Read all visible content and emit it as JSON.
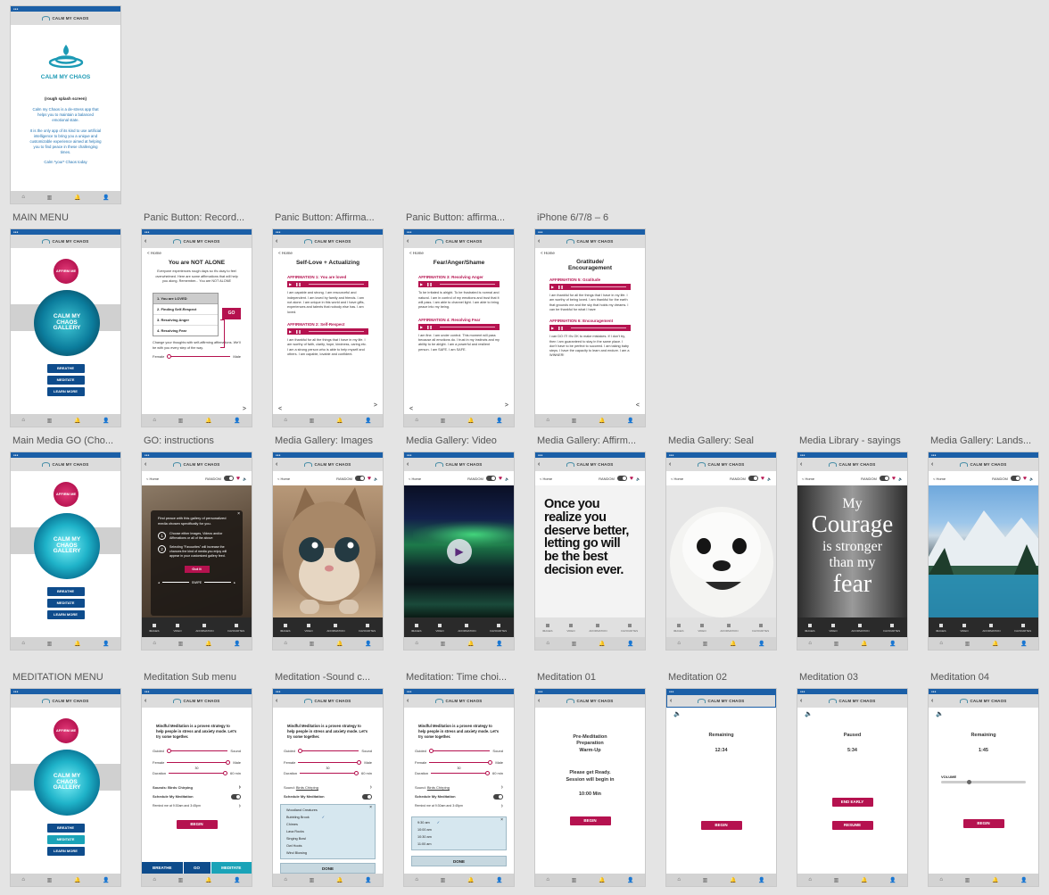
{
  "app_name": "CALM MY CHAOS",
  "tabbar": [
    "⌂",
    "▥",
    "🔔",
    "👤"
  ],
  "splash": {
    "logo_text": "CALM MY CHAOS",
    "note": "(rough splash screen)",
    "p1": "Calm my Chaos is a de-stress app that helps you to maintain a balanced emotional state.",
    "p2": "It is the only app of its kind to use artificial intelligence to bring you a unique and customizable experience aimed at helping you to find peace in these challenging times.",
    "p3": "Calm *your* Chaos today"
  },
  "labels": {
    "main_menu": "MAIN MENU",
    "panic_record": "Panic Button: Record...",
    "panic_affirm": "Panic Button: Affirma...",
    "panic_affirm2": "Panic Button: affirma...",
    "iphone": "iPhone 6/7/8 – 6",
    "main_media": "Main Media GO (Cho...",
    "go_instr": "GO: instructions",
    "mg_images": "Media Gallery: Images",
    "mg_video": "Media Gallery: Video",
    "mg_affirm": "Media Gallery: Affirm...",
    "mg_seal": "Media Gallery: Seal",
    "ml_sayings": "Media Library - sayings",
    "mg_lands": "Media Gallery: Lands...",
    "med_menu": "MEDITATION MENU",
    "med_sub": "Meditation Sub menu",
    "med_sound": "Meditation -Sound c...",
    "med_time": "Meditation: Time choi...",
    "med01": "Meditation 01",
    "med02": "Meditation 02",
    "med03": "Meditation 03",
    "med04": "Meditation 04"
  },
  "menu": {
    "affirm": "AFFIRM ME",
    "gallery": "CALM MY CHAOS GALLERY",
    "breathe": "BREATHE",
    "meditate": "MEDITATE",
    "learn": "LEARN MORE"
  },
  "panic1": {
    "home": "< Home",
    "title": "You are NOT ALONE",
    "intro": "Everyone experiences rough days so it's okay to feel overwhelmed. Here are some affirmations that will help you along. Remember... You are NOT ALONE",
    "options": [
      "1. You are LOVED",
      "2. Finding Self-Respect",
      "3. Resolving Anger",
      "4. Resolving Fear"
    ],
    "go": "GO",
    "change": "Change your thoughts with self-affirming affirmations. We'll be with you every step of the way.",
    "female": "Female",
    "male": "Male",
    "next": ">"
  },
  "panic2": {
    "home": "< Home",
    "title": "Self-Love + Actualizing",
    "a1": "AFFIRMATION 1: You are loved",
    "t1": "I am capable and strong. I am resourceful and independent. I am loved by family and friends. I am not alone. I am unique in this world and I have gifts, experiences and talents that nobody else has. I am loved.",
    "a2": "AFFIRMATION 2: Self-Respect",
    "t2": "I am thankful for all the things that I have in my life. I am worthy of faith, clarity, hope, kindness, caring etc. I am a strong person who is able to help myself and others. I am capable, lovable and confident.",
    "prev": "<",
    "next": ">"
  },
  "panic3": {
    "home": "< Home",
    "title": "Fear/Anger/Shame",
    "a1": "AFFIRMATION 3: Resolving Anger",
    "t1": "To be irritated is alright. To be frustrated is normal and natural. I am in control of my emotions and trust that it will pass. I am able to channel light. I am able to bring peace into my being.",
    "a2": "AFFIRMATION 4: Resolving Fear",
    "t2": "I am fine. I am under control. This moment will pass because all emotions do. I trust in my instincts and my ability to be alright. I am a powerful and resilient person. I am SAFE. I am SAFE.",
    "prev": "<",
    "next": ">"
  },
  "panic4": {
    "home": "< Home",
    "title": "Gratitude/ Encouragement",
    "a1": "AFFIRMATION 5: Gratitude",
    "t1": "I am thankful for all the things that I have in my life. I am worthy of being loved. I am thankful for the earth that grounds me and the sky that holds my dreams. I can be thankful for what I have",
    "a2": "AFFIRMATION 6: Encouragement",
    "t2": "I can DO IT! It's OK to make mistakes. If I don't try, then I am guaranteed to stay in the same place. I don't have to be perfect to succeed. I am taking baby steps. I have the capacity to learn and endure. I am a WINNER!",
    "prev": "<"
  },
  "media": {
    "home": "< Home",
    "random": "RANDOM",
    "nav": [
      "IMAGES",
      "VIDEO",
      "AFFIRMATION",
      "FAVOURITES"
    ]
  },
  "go_instr": {
    "intro": "Find peace with this gallery of personalized media chosen specifically for you.",
    "s1": "Choose either Images, Videos and/or Affirmations or all of the above",
    "s2": "Selecting \"Favourites\" will increase the chances the kind of media you enjoy will appear in your customized gallery feed.",
    "got": "Got It",
    "swipe": "SWIPE"
  },
  "affirm_card": "Once you realize you deserve better, letting go will be the best decision ever.",
  "saying": {
    "l1": "My",
    "l2": "Courage",
    "l3": "is stronger",
    "l4": "than my",
    "l5": "fear"
  },
  "med": {
    "intro": "Mindful Meditation is a proven strategy to help people in stress and anxiety mode. Let's try some together.",
    "guided": "Guided",
    "sound": "Sound",
    "female": "Female",
    "male": "Male",
    "duration": "Duration",
    "d_val": "60 min",
    "d_mid": "30",
    "sounds": "Sounds: Birds Chirping",
    "sound_lbl": "Sound:",
    "sound_val": "Birds Chirping",
    "schedule": "Schedule My Meditation",
    "remind": "Remind me at 9:30am and 3:45pm",
    "begin": "BEGIN",
    "bottom": [
      "BREATHE",
      "GO",
      "MEDITATE"
    ],
    "sound_list": [
      "Woodland Creatures",
      "Bubbling Brook",
      "Chimes",
      "Lava Rocks",
      "Singing Bowl",
      "Owl Hoots",
      "Wind Blowing"
    ],
    "time_list": [
      "9:30 am",
      "10:00 am",
      "10:30 am",
      "11:00 am"
    ],
    "done": "DONE"
  },
  "m01": {
    "l1": "Pre-Meditation",
    "l2": "Preparation",
    "l3": "Warm-Up",
    "l4": "Please get Ready.",
    "l5": "Session will begin in",
    "l6": "10:00 Min",
    "begin": "BEGIN"
  },
  "m02": {
    "label": "Remaining",
    "time": "12:34",
    "begin": "BEGIN"
  },
  "m03": {
    "label": "Paused",
    "time": "5:34",
    "end": "END EARLY",
    "resume": "RESUME"
  },
  "m04": {
    "label": "Remaining",
    "time": "1:45",
    "volume": "VOLUME",
    "begin": "BEGIN"
  }
}
